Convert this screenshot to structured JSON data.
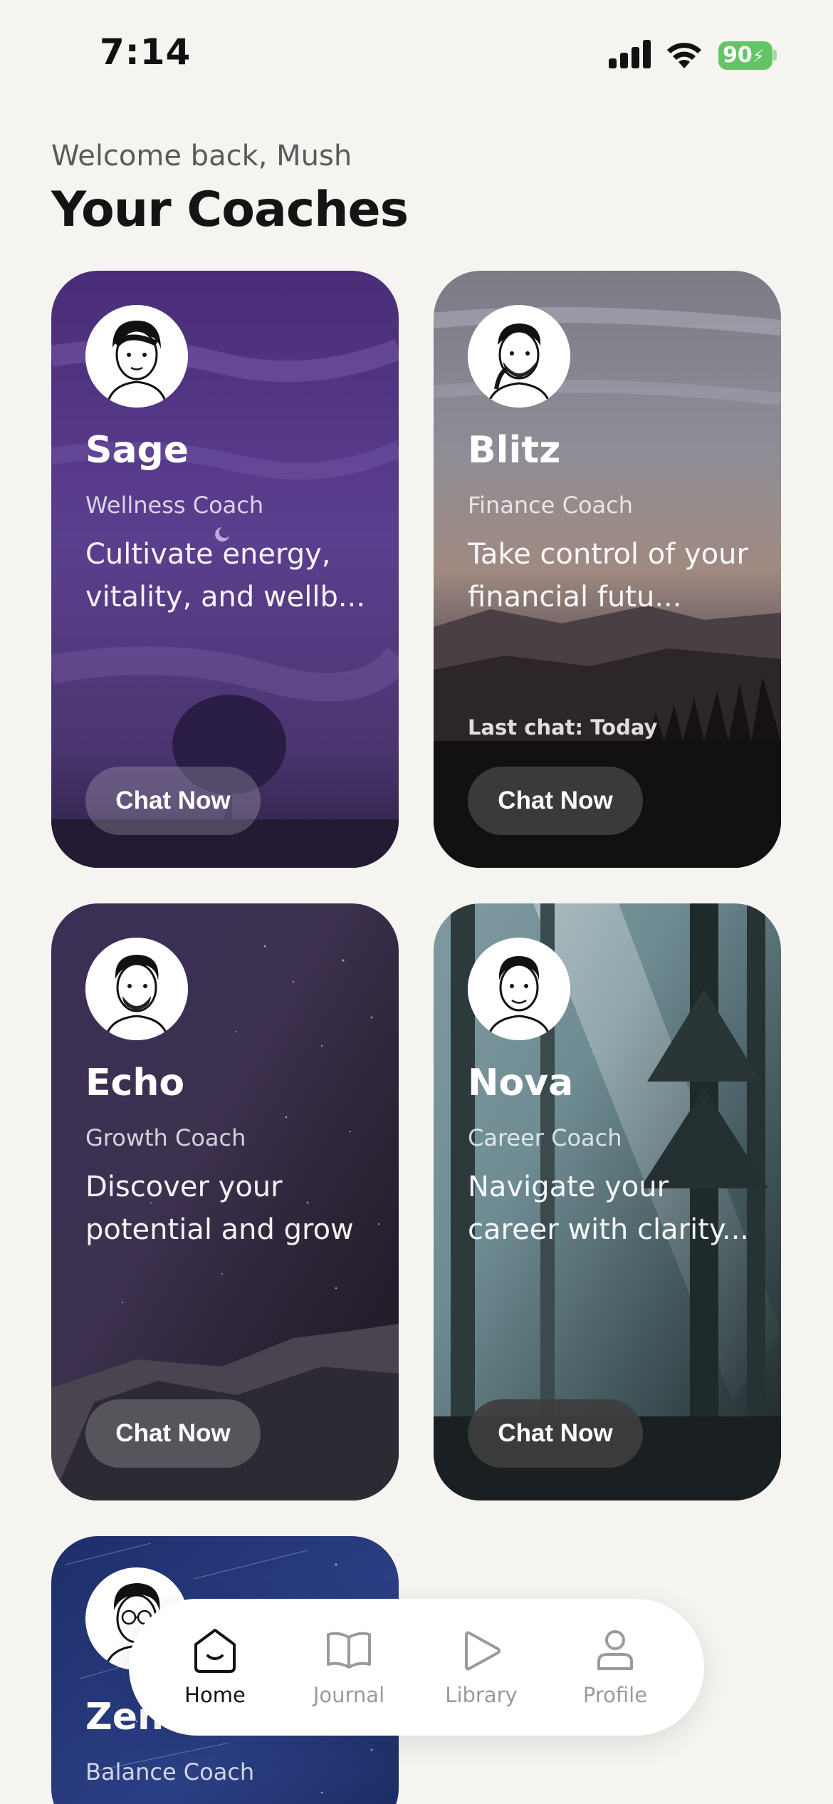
{
  "status_bar": {
    "time": "7:14",
    "battery": "90"
  },
  "header": {
    "welcome": "Welcome back, Mush",
    "title": "Your Coaches"
  },
  "coaches": [
    {
      "name": "Sage",
      "role": "Wellness Coach",
      "description": "Cultivate energy, vitality, and wellb...",
      "button": "Chat Now"
    },
    {
      "name": "Blitz",
      "role": "Finance Coach",
      "description": "Take control of your financial futu...",
      "last_chat": "Last chat: Today",
      "button": "Chat Now"
    },
    {
      "name": "Echo",
      "role": "Growth Coach",
      "description": "Discover your potential and grow",
      "button": "Chat Now"
    },
    {
      "name": "Nova",
      "role": "Career Coach",
      "description": "Navigate your career with clarity...",
      "button": "Chat Now"
    },
    {
      "name": "Zen",
      "role": "Balance Coach"
    }
  ],
  "nav": {
    "items": [
      {
        "label": "Home",
        "icon": "home-icon",
        "active": true
      },
      {
        "label": "Journal",
        "icon": "book-icon"
      },
      {
        "label": "Library",
        "icon": "play-icon"
      },
      {
        "label": "Profile",
        "icon": "person-icon"
      }
    ]
  },
  "colors": {
    "background": "#f5f4f0",
    "battery": "#65c466",
    "nav_bg": "#ffffff"
  }
}
